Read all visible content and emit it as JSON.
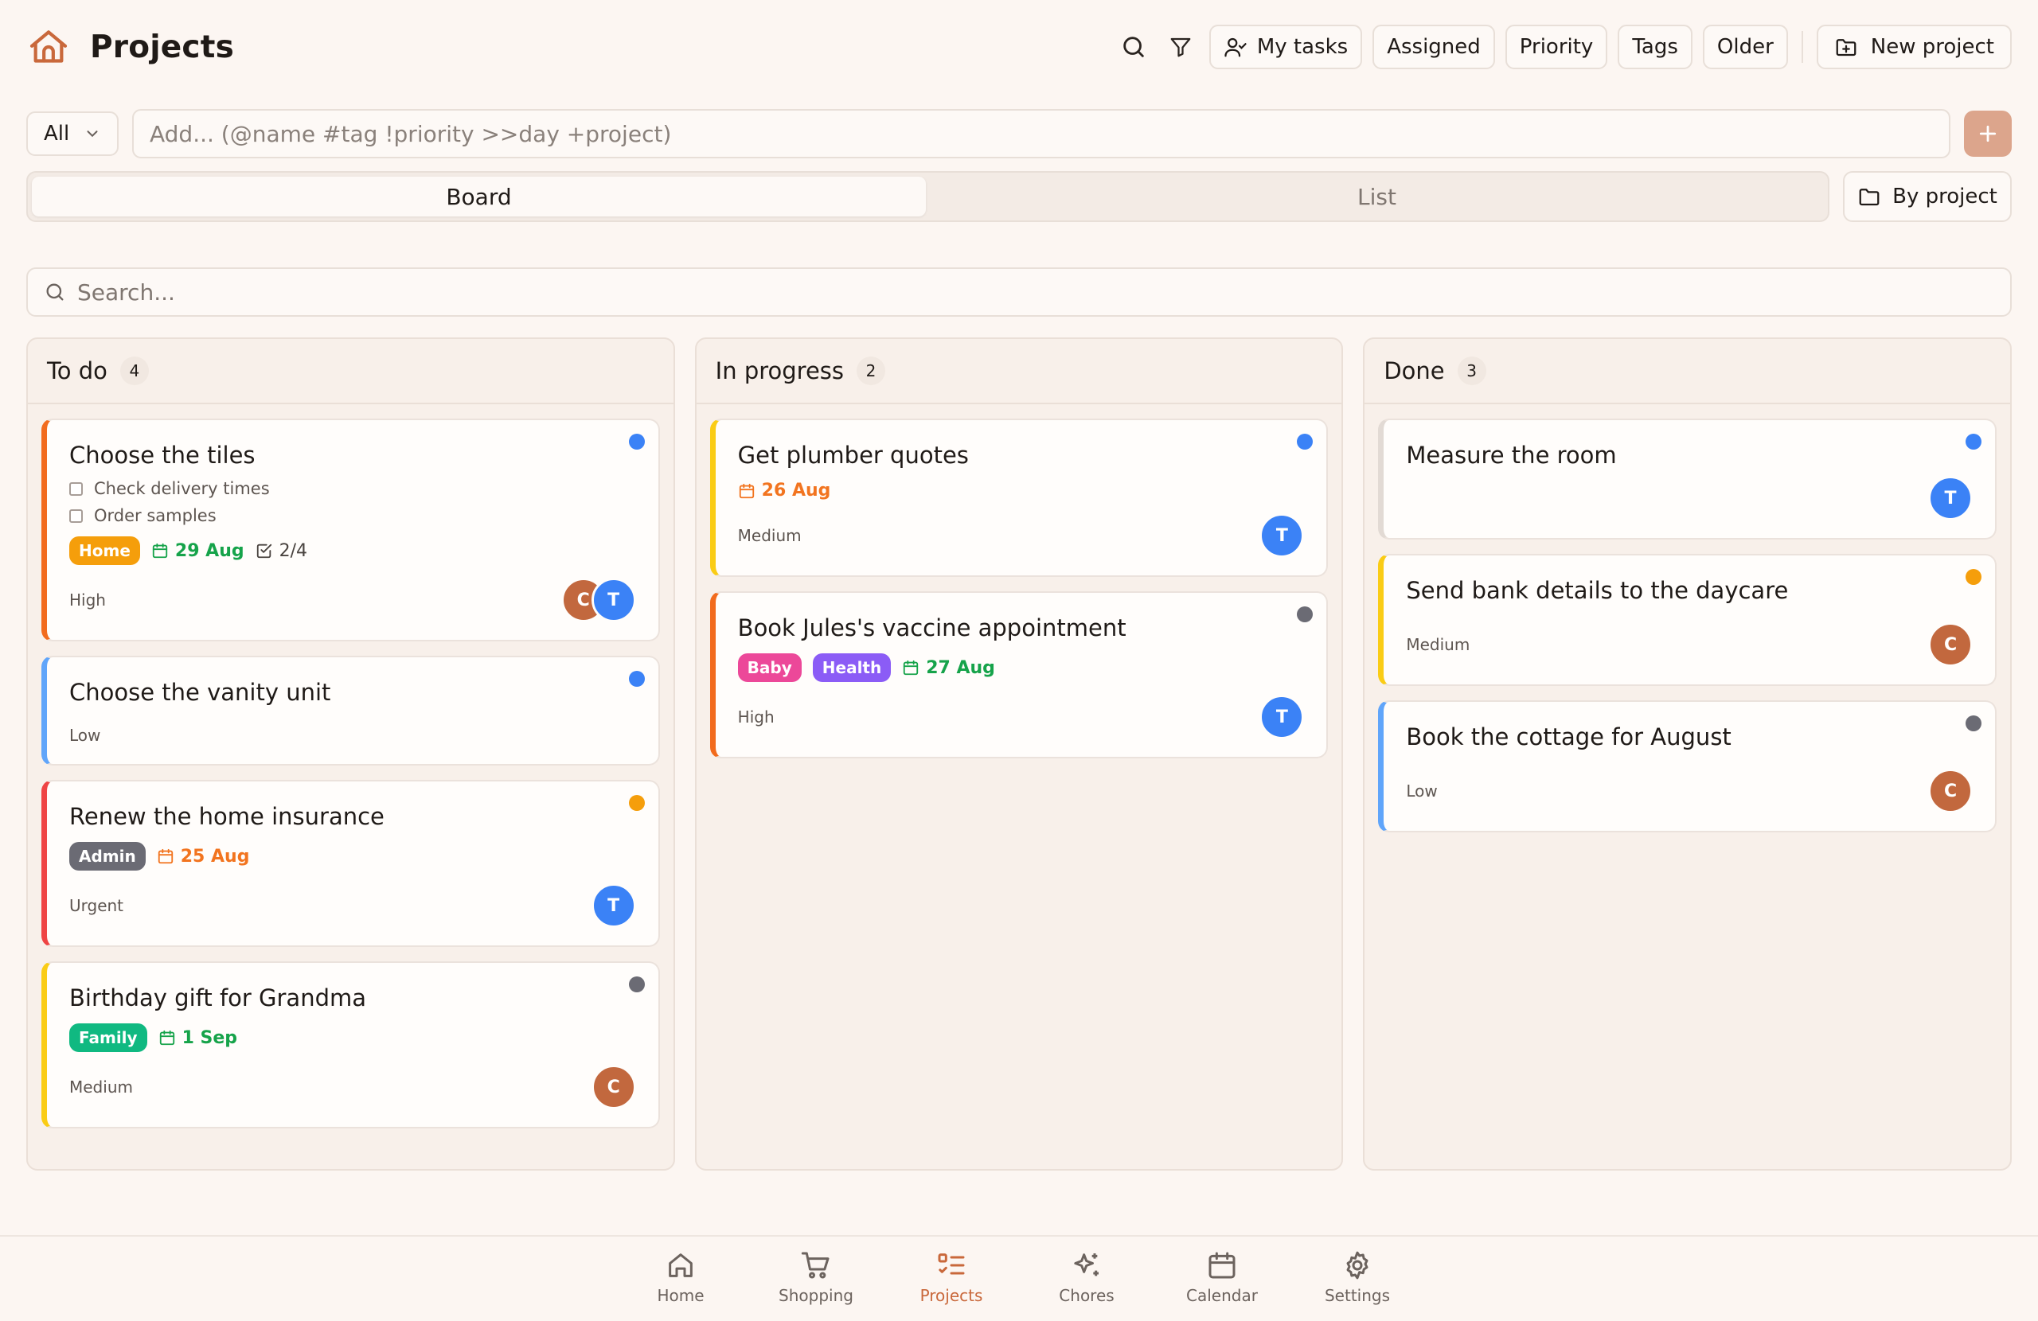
{
  "header": {
    "title": "Projects",
    "buttons": {
      "my_tasks": "My tasks",
      "assigned": "Assigned",
      "priority": "Priority",
      "tags": "Tags",
      "older": "Older",
      "new_project": "New project"
    }
  },
  "add_row": {
    "scope": "All",
    "placeholder": "Add... (@name #tag !priority >>day +project)"
  },
  "view": {
    "tabs": [
      "Board",
      "List"
    ],
    "active": "Board",
    "group_by": "By project"
  },
  "search": {
    "placeholder": "Search..."
  },
  "columns": [
    {
      "title": "To do",
      "count": "4",
      "cards": [
        {
          "title": "Choose the tiles",
          "accent": "#f26b1d",
          "dot": "#3b82f6",
          "subtasks": [
            "Check delivery times",
            "Order samples"
          ],
          "tags": [
            {
              "label": "Home",
              "color": "#f59e0b"
            }
          ],
          "date": {
            "label": "29 Aug",
            "color": "#16a34a"
          },
          "progress": "2/4",
          "priority": "High",
          "avatars": [
            {
              "initial": "C",
              "color": "#c2683e"
            },
            {
              "initial": "T",
              "color": "#3b82f6"
            }
          ]
        },
        {
          "title": "Choose the vanity unit",
          "accent": "#60a5fa",
          "dot": "#3b82f6",
          "priority": "Low"
        },
        {
          "title": "Renew the home insurance",
          "accent": "#ef4444",
          "dot": "#f59e0b",
          "tags": [
            {
              "label": "Admin",
              "color": "#6b6b74"
            }
          ],
          "date": {
            "label": "25 Aug",
            "color": "#f2741f"
          },
          "priority": "Urgent",
          "avatars": [
            {
              "initial": "T",
              "color": "#3b82f6"
            }
          ]
        },
        {
          "title": "Birthday gift for Grandma",
          "accent": "#facc15",
          "dot": "#6b6b74",
          "tags": [
            {
              "label": "Family",
              "color": "#10b981"
            }
          ],
          "date": {
            "label": "1 Sep",
            "color": "#16a34a"
          },
          "priority": "Medium",
          "avatars": [
            {
              "initial": "C",
              "color": "#c2683e"
            }
          ]
        }
      ]
    },
    {
      "title": "In progress",
      "count": "2",
      "cards": [
        {
          "title": "Get plumber quotes",
          "accent": "#facc15",
          "dot": "#3b82f6",
          "date": {
            "label": "26 Aug",
            "color": "#f2741f"
          },
          "priority": "Medium",
          "avatars": [
            {
              "initial": "T",
              "color": "#3b82f6"
            }
          ]
        },
        {
          "title": "Book Jules's vaccine appointment",
          "accent": "#f26b1d",
          "dot": "#6b6b74",
          "tags": [
            {
              "label": "Baby",
              "color": "#ec4899"
            },
            {
              "label": "Health",
              "color": "#8b5cf6"
            }
          ],
          "date": {
            "label": "27 Aug",
            "color": "#16a34a"
          },
          "priority": "High",
          "avatars": [
            {
              "initial": "T",
              "color": "#3b82f6"
            }
          ]
        }
      ]
    },
    {
      "title": "Done",
      "count": "3",
      "cards": [
        {
          "title": "Measure the room",
          "accent": "#e2dad4",
          "dot": "#3b82f6",
          "priority": "",
          "avatars": [
            {
              "initial": "T",
              "color": "#3b82f6"
            }
          ]
        },
        {
          "title": "Send bank details to the daycare",
          "accent": "#facc15",
          "dot": "#f59e0b",
          "priority": "Medium",
          "avatars": [
            {
              "initial": "C",
              "color": "#c2683e"
            }
          ]
        },
        {
          "title": "Book the cottage for August",
          "accent": "#60a5fa",
          "dot": "#6b6b74",
          "priority": "Low",
          "avatars": [
            {
              "initial": "C",
              "color": "#c2683e"
            }
          ]
        }
      ]
    }
  ],
  "nav": [
    {
      "label": "Home",
      "icon": "home-icon"
    },
    {
      "label": "Shopping",
      "icon": "cart-icon"
    },
    {
      "label": "Projects",
      "icon": "projects-icon",
      "active": true
    },
    {
      "label": "Chores",
      "icon": "sparkles-icon"
    },
    {
      "label": "Calendar",
      "icon": "calendar-icon"
    },
    {
      "label": "Settings",
      "icon": "gear-icon"
    }
  ]
}
